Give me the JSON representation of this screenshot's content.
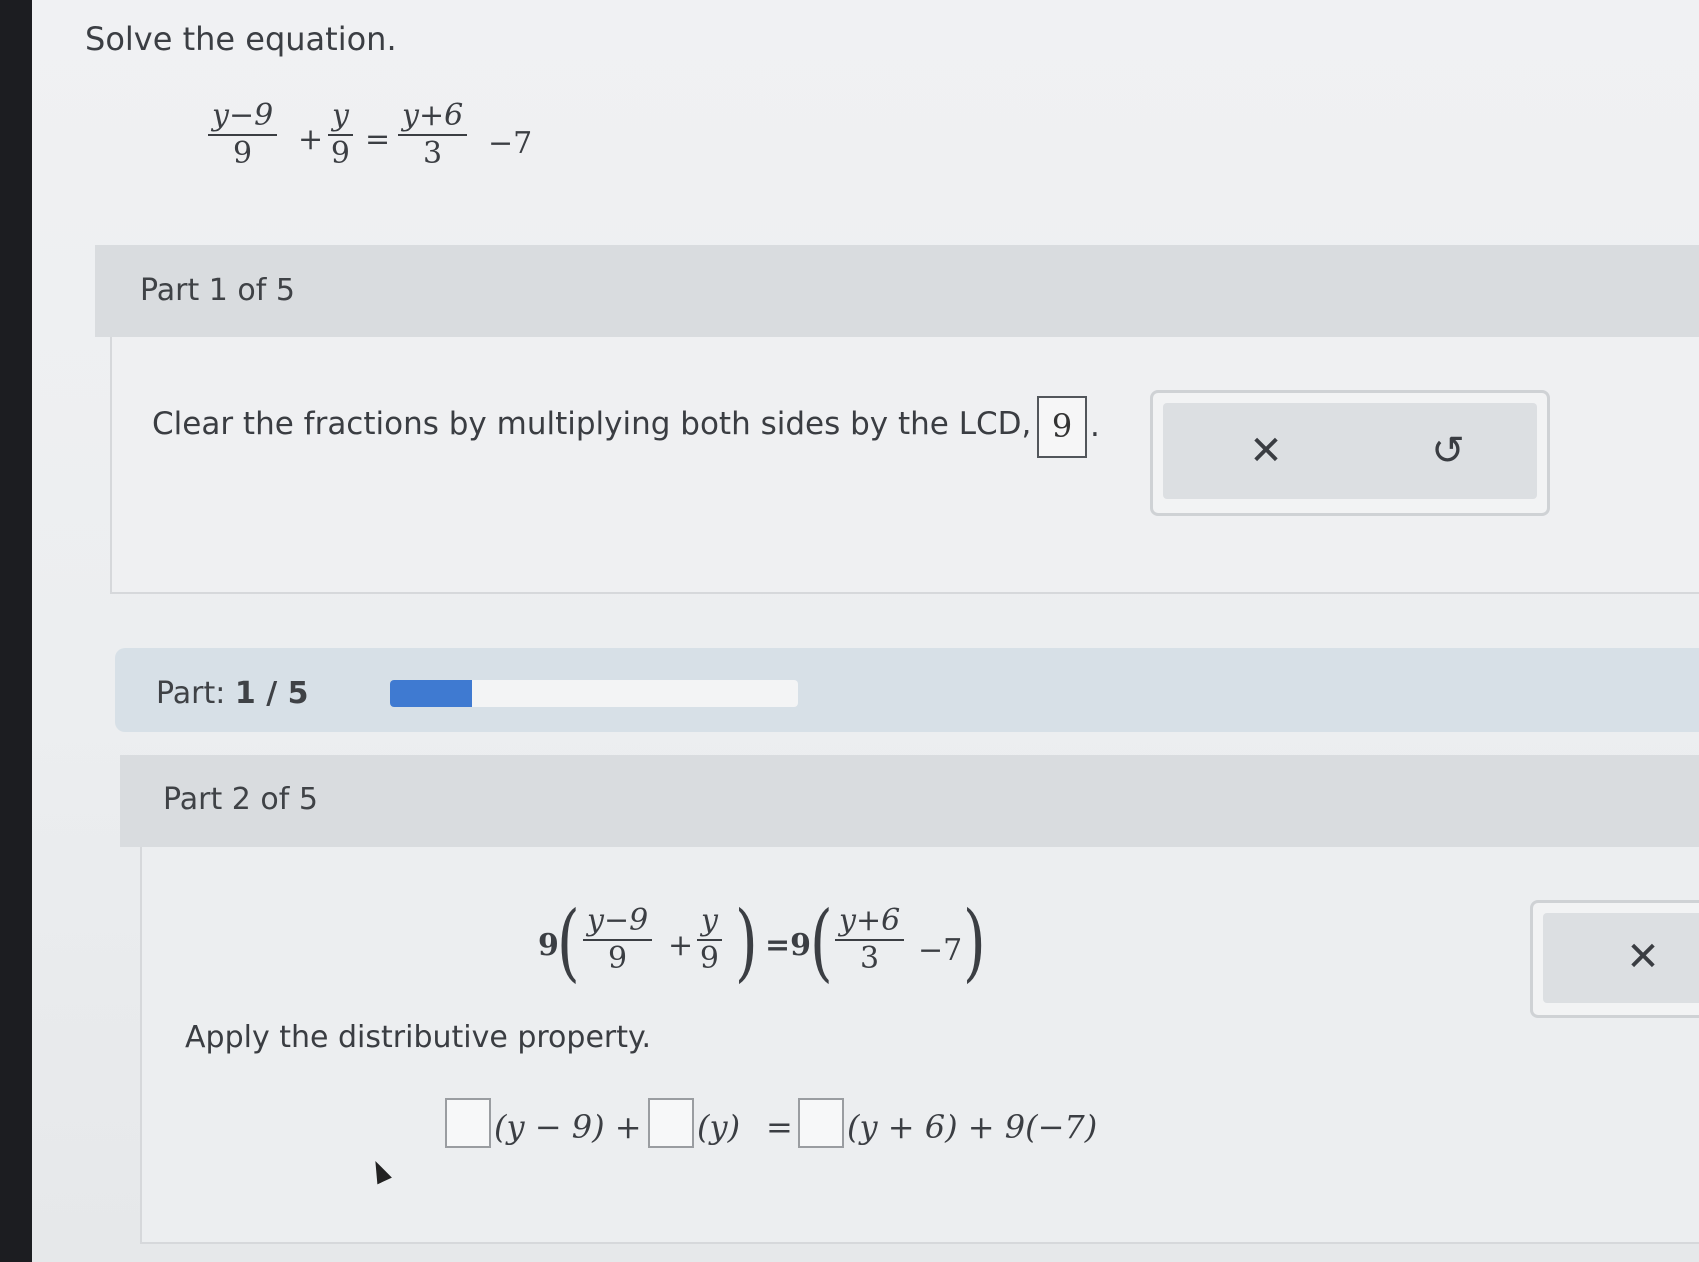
{
  "problem": {
    "prompt": "Solve the equation.",
    "equation": {
      "t1_num": "y−9",
      "t1_den": "9",
      "plus": "+",
      "t2_num": "y",
      "t2_den": "9",
      "equals": "=",
      "t3_num": "y+6",
      "t3_den": "3",
      "tail": "−7"
    }
  },
  "part1": {
    "header": "Part 1 of 5",
    "instruction": "Clear the fractions by multiplying both sides by the LCD,",
    "lcd_value": "9",
    "period": "."
  },
  "actions": {
    "clear_icon": "close-icon",
    "undo_icon": "undo-icon",
    "clear_glyph": "✕",
    "undo_glyph": "↺"
  },
  "progress": {
    "label": "Part:",
    "value": "1 / 5",
    "fraction": 0.2,
    "fill_color": "#3f7ad1"
  },
  "part2": {
    "header": "Part 2 of 5",
    "equation": {
      "lead": "9",
      "f1_num": "y−9",
      "f1_den": "9",
      "plus": "+",
      "f2_num": "y",
      "f2_den": "9",
      "equals_nine": "=9",
      "f3_num": "y+6",
      "f3_den": "3",
      "tail": "−7"
    },
    "instruction": "Apply the distributive property.",
    "distributed": {
      "seg1": "(y − 9) +",
      "seg2": "(y)",
      "eq": "=",
      "seg3": "(y + 6) + 9(−7)"
    }
  }
}
